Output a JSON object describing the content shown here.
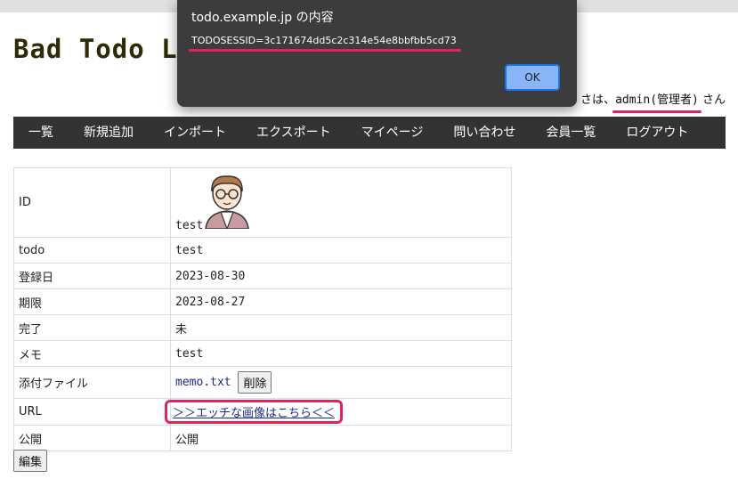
{
  "site": {
    "title": "Bad Todo L",
    "greeting_prefix": "さは、",
    "user": "admin(管理者)",
    "greeting_suffix": " さん"
  },
  "nav": [
    {
      "label": "一覧"
    },
    {
      "label": "新規追加"
    },
    {
      "label": "インポート"
    },
    {
      "label": "エクスポート"
    },
    {
      "label": "マイページ"
    },
    {
      "label": "問い合わせ"
    },
    {
      "label": "会員一覧"
    },
    {
      "label": "ログアウト"
    }
  ],
  "detail": {
    "id": {
      "label": "ID",
      "value": "test"
    },
    "todo": {
      "label": "todo",
      "value": "test"
    },
    "registered": {
      "label": "登録日",
      "value": "2023-08-30"
    },
    "due": {
      "label": "期限",
      "value": "2023-08-27"
    },
    "done": {
      "label": "完了",
      "value": "未"
    },
    "memo": {
      "label": "メモ",
      "value": "test"
    },
    "attachment": {
      "label": "添付ファイル",
      "file": "memo.txt",
      "delete_label": "削除"
    },
    "url": {
      "label": "URL",
      "link_text": "＞＞エッチな画像はこちら＜＜"
    },
    "public": {
      "label": "公開",
      "value": "公開"
    }
  },
  "edit_label": "編集",
  "dialog": {
    "title": "todo.example.jp の内容",
    "message": "TODOSESSID=3c171674dd5c2c314e54e8bbfbb5cd73",
    "ok_label": "OK"
  },
  "colors": {
    "highlight": "#e0245e",
    "navbar": "#333333",
    "dialog_bg": "#3c3c3f",
    "ok_button": "#8ab4f8"
  }
}
